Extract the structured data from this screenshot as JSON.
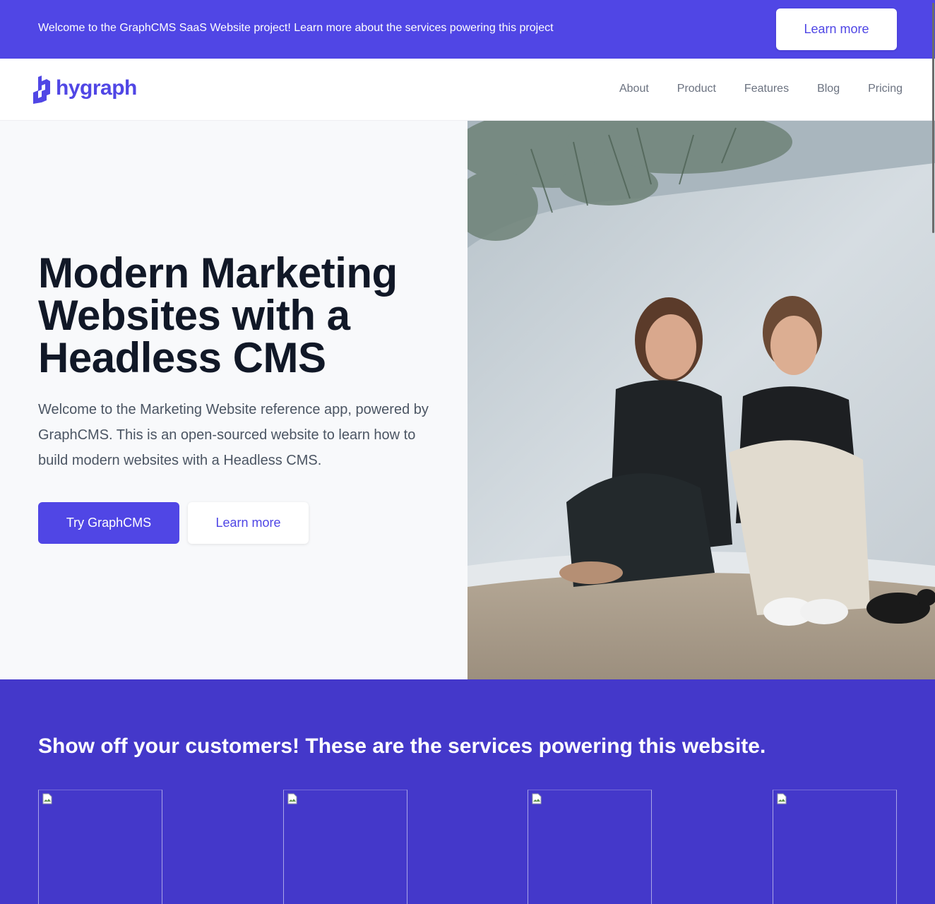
{
  "banner": {
    "text": "Welcome to the GraphCMS SaaS Website project! Learn more about the services powering this project",
    "button_label": "Learn more"
  },
  "nav": {
    "logo_text": "hygraph",
    "links": [
      "About",
      "Product",
      "Features",
      "Blog",
      "Pricing"
    ]
  },
  "hero": {
    "title": "Modern Marketing Websites with a Headless CMS",
    "description": "Welcome to the Marketing Website reference app, powered by GraphCMS. This is an open-sourced website to learn how to build modern websites with a Headless CMS.",
    "primary_button": "Try GraphCMS",
    "secondary_button": "Learn more"
  },
  "customers": {
    "title": "Show off your customers! These are the services powering this website.",
    "logo_count_visible": 4
  },
  "colors": {
    "brand": "#5046e5",
    "customers_bg": "#4438ca",
    "hero_bg": "#f8f9fb",
    "heading": "#111827",
    "body_text": "#4b5563",
    "nav_text": "#6b7280"
  },
  "icons": [
    "hygraph-logo-icon",
    "broken-image-icon"
  ]
}
